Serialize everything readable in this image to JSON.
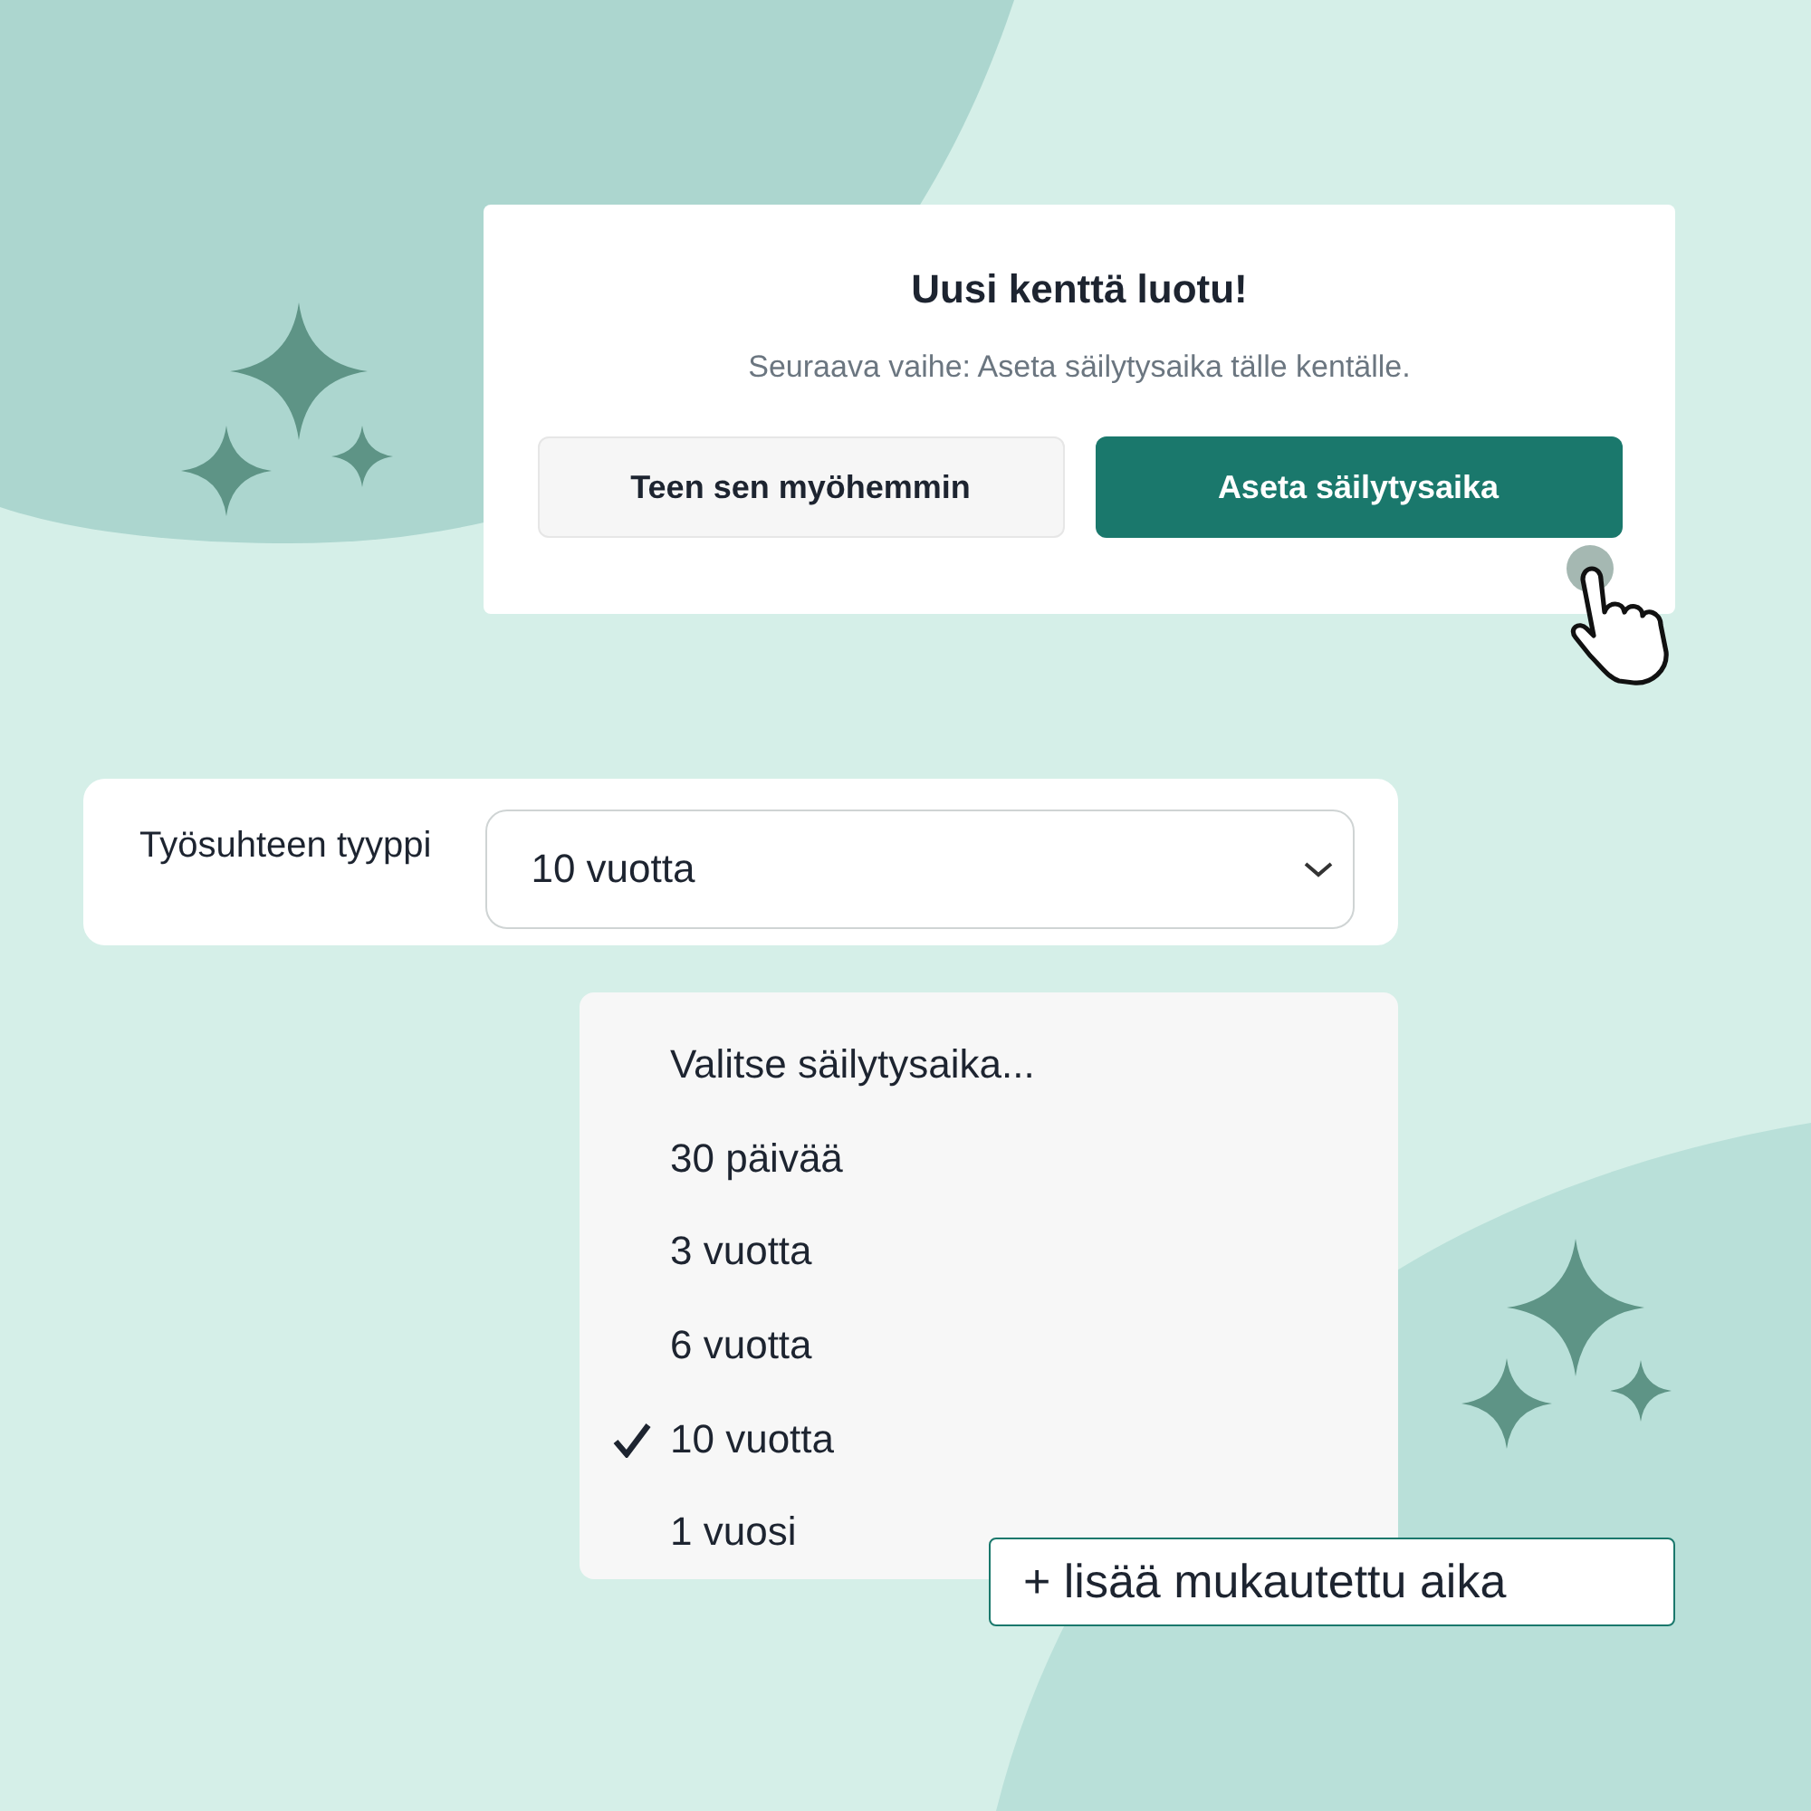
{
  "dialog": {
    "title": "Uusi kenttä luotu!",
    "message": "Seuraava vaihe: Aseta säilytysaika tälle kentälle.",
    "buttons": [
      {
        "label": "Teen sen myöhemmin",
        "kind": "secondary"
      },
      {
        "label": "Aseta säilytysaika",
        "kind": "primary"
      }
    ]
  },
  "field": {
    "label": "Työsuhteen tyyppi",
    "value": "10 vuotta"
  },
  "dropdown": {
    "options": [
      {
        "label": "Valitse säilytysaika...",
        "selected": false
      },
      {
        "label": "30 päivää",
        "selected": false
      },
      {
        "label": "3 vuotta",
        "selected": false
      },
      {
        "label": "6 vuotta",
        "selected": false
      },
      {
        "label": "10 vuotta",
        "selected": true
      },
      {
        "label": "1 vuosi",
        "selected": false
      }
    ]
  },
  "add_custom_button": {
    "label": "+ lisää mukautettu aika"
  }
}
